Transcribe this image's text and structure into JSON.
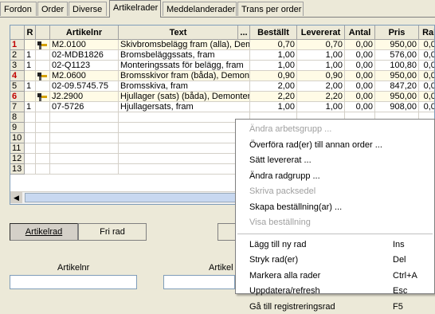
{
  "tabs": [
    "Fordon",
    "Order",
    "Diverse",
    "Artikelrader",
    "Meddelanderader",
    "Trans per order"
  ],
  "grid": {
    "headers": [
      "R",
      "Artikelnr",
      "Text",
      "...",
      "Beställt",
      "Levererat",
      "Antal",
      "Pris",
      "Rab"
    ],
    "rows": [
      {
        "n": "1",
        "red": true,
        "icon": true,
        "r": "",
        "art": "M2.0100",
        "text": "Skivbromsbelägg fram (alla), Demon",
        "best": "0,70",
        "lev": "0,70",
        "antal": "0,00",
        "pris": "950,00",
        "rab": "0,00"
      },
      {
        "n": "2",
        "red": false,
        "icon": false,
        "r": "1",
        "art": "02-MDB1826",
        "text": "Bromsbeläggssats, fram",
        "best": "1,00",
        "lev": "1,00",
        "antal": "0,00",
        "pris": "576,00",
        "rab": "0,00"
      },
      {
        "n": "3",
        "red": false,
        "icon": false,
        "r": "1",
        "art": "02-Q1123",
        "text": "Monteringssats för belägg, fram",
        "best": "1,00",
        "lev": "1,00",
        "antal": "0,00",
        "pris": "100,80",
        "rab": "0,00"
      },
      {
        "n": "4",
        "red": true,
        "icon": true,
        "r": "",
        "art": "M2.0600",
        "text": "Bromsskivor fram (båda), Demont",
        "best": "0,90",
        "lev": "0,90",
        "antal": "0,00",
        "pris": "950,00",
        "rab": "0,00"
      },
      {
        "n": "5",
        "red": false,
        "icon": false,
        "r": "1",
        "art": "02-09.5745.75",
        "text": "Bromsskiva, fram",
        "best": "2,00",
        "lev": "2,00",
        "antal": "0,00",
        "pris": "847,20",
        "rab": "0,00"
      },
      {
        "n": "6",
        "red": true,
        "icon": true,
        "r": "",
        "art": "J2.2900",
        "text": "Hjullager (sats) (båda), Demonteri",
        "best": "2,20",
        "lev": "2,20",
        "antal": "0,00",
        "pris": "950,00",
        "rab": "0,00"
      },
      {
        "n": "7",
        "red": false,
        "icon": false,
        "r": "1",
        "art": "07-5726",
        "text": "Hjullagersats, fram",
        "best": "1,00",
        "lev": "1,00",
        "antal": "0,00",
        "pris": "908,00",
        "rab": "0,00"
      },
      {
        "n": "8"
      },
      {
        "n": "9"
      },
      {
        "n": "10"
      },
      {
        "n": "11"
      },
      {
        "n": "12"
      },
      {
        "n": "13"
      }
    ]
  },
  "buttons": {
    "artikelrad": "Artikelrad",
    "fri_rad": "Fri rad"
  },
  "labels": {
    "artikelnr": "Artikelnr",
    "artikel2": "Artikel"
  },
  "menu": [
    {
      "label": "Ändra arbetsgrupp ...",
      "disabled": true,
      "shortcut": ""
    },
    {
      "label": "Överföra rad(er) till annan order ...",
      "disabled": false,
      "shortcut": ""
    },
    {
      "label": "Sätt levererat ...",
      "disabled": false,
      "shortcut": ""
    },
    {
      "label": "Ändra radgrupp ...",
      "disabled": false,
      "shortcut": ""
    },
    {
      "label": "Skriva packsedel",
      "disabled": true,
      "shortcut": ""
    },
    {
      "label": "Skapa beställning(ar) ...",
      "disabled": false,
      "shortcut": ""
    },
    {
      "label": "Visa beställning",
      "disabled": true,
      "shortcut": ""
    },
    {
      "label": "Lägg till ny rad",
      "disabled": false,
      "shortcut": "Ins"
    },
    {
      "label": "Stryk rad(er)",
      "disabled": false,
      "shortcut": "Del"
    },
    {
      "label": "Markera alla rader",
      "disabled": false,
      "shortcut": "Ctrl+A"
    },
    {
      "label": "Uppdatera/refresh",
      "disabled": false,
      "shortcut": "Esc"
    },
    {
      "label": "Gå till registreringsrad",
      "disabled": false,
      "shortcut": "F5"
    }
  ]
}
